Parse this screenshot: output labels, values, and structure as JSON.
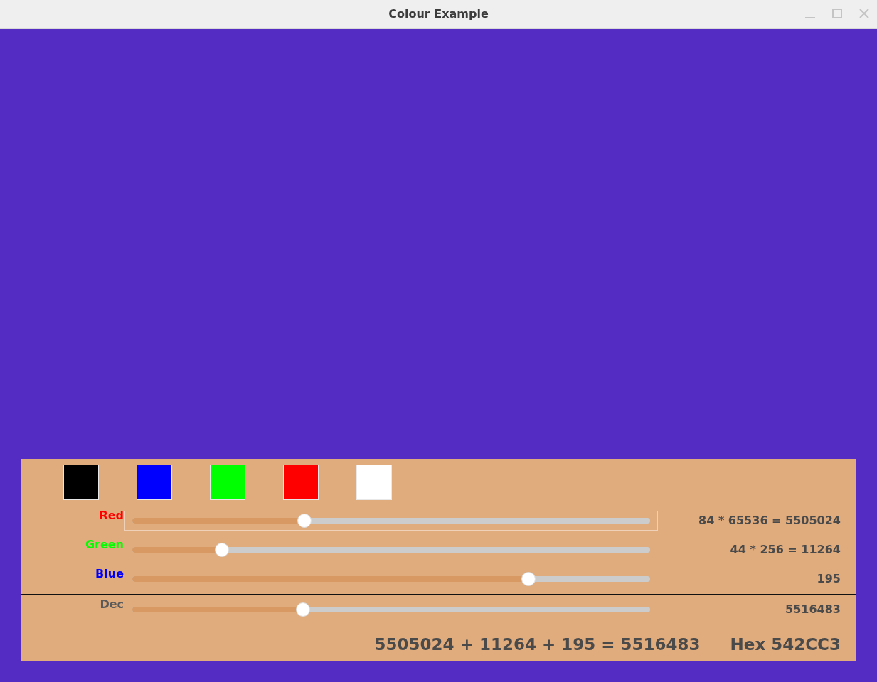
{
  "window": {
    "title": "Colour Example"
  },
  "preview": {
    "color": "#542cc3"
  },
  "swatches": [
    {
      "color": "#000000"
    },
    {
      "color": "#0000ff"
    },
    {
      "color": "#00ff00"
    },
    {
      "color": "#ff0000"
    },
    {
      "color": "#ffffff"
    }
  ],
  "channels": [
    {
      "kind": "component",
      "label": "Red",
      "color": "#ff0000",
      "level": 0.332,
      "focused": true,
      "reading": "84 * 65536 = 5505024"
    },
    {
      "kind": "component",
      "label": "Green",
      "color": "#00ff00",
      "level": 0.173,
      "focused": false,
      "reading": "44 * 256 = 11264"
    },
    {
      "kind": "component",
      "label": "Blue",
      "color": "#0000ff",
      "level": 0.765,
      "focused": false,
      "reading": "195"
    },
    {
      "kind": "decimal",
      "label": "Dec",
      "level": 0.329,
      "focused": false,
      "reading": "5516483"
    }
  ],
  "summary": {
    "sum": "5505024 + 11264 + 195 = 5516483",
    "hex": "Hex 542CC3"
  }
}
